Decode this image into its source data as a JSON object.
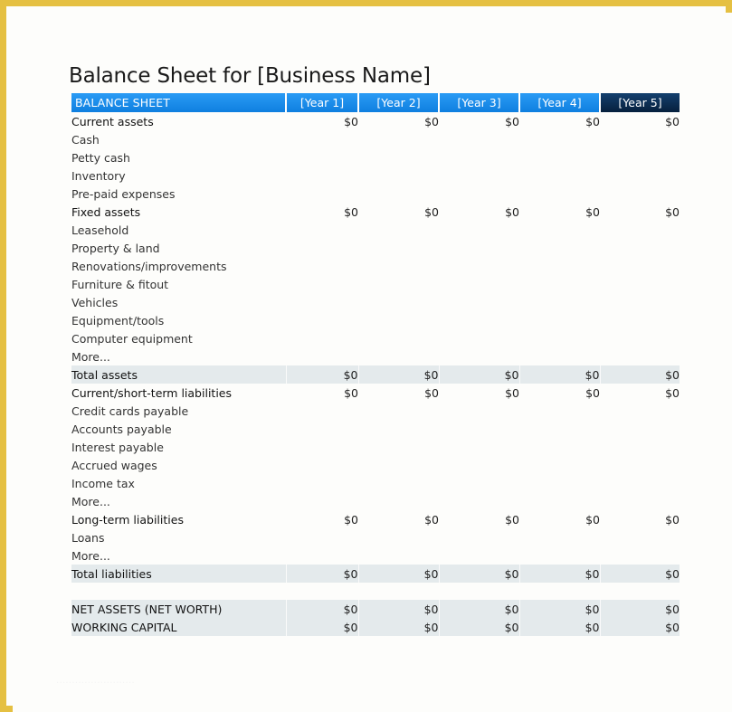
{
  "document": {
    "title": "Balance Sheet for [Business Name]",
    "frame_color": "#e5c042",
    "background_color": "#fdfdfb",
    "watermark": "........................."
  },
  "table": {
    "header": {
      "label": "BALANCE SHEET",
      "label_bg": "#1b8ef2",
      "year_bg": "#1b8ef2",
      "year_last_bg": "#0b2f55",
      "columns": [
        "[Year 1]",
        "[Year 2]",
        "[Year 3]",
        "[Year 4]",
        "[Year 5]"
      ]
    },
    "total_row_bg": "#e4eaec",
    "zero": "$0",
    "rows": [
      {
        "label": "Current assets",
        "kind": "section",
        "values": [
          "$0",
          "$0",
          "$0",
          "$0",
          "$0"
        ]
      },
      {
        "label": "Cash",
        "kind": "item",
        "values": [
          "",
          "",
          "",
          "",
          ""
        ]
      },
      {
        "label": "Petty cash",
        "kind": "item",
        "values": [
          "",
          "",
          "",
          "",
          ""
        ]
      },
      {
        "label": "Inventory",
        "kind": "item",
        "values": [
          "",
          "",
          "",
          "",
          ""
        ]
      },
      {
        "label": "Pre-paid expenses",
        "kind": "item",
        "values": [
          "",
          "",
          "",
          "",
          ""
        ]
      },
      {
        "label": "Fixed assets",
        "kind": "section",
        "values": [
          "$0",
          "$0",
          "$0",
          "$0",
          "$0"
        ]
      },
      {
        "label": "Leasehold",
        "kind": "item",
        "values": [
          "",
          "",
          "",
          "",
          ""
        ]
      },
      {
        "label": "Property & land",
        "kind": "item",
        "values": [
          "",
          "",
          "",
          "",
          ""
        ]
      },
      {
        "label": "Renovations/improvements",
        "kind": "item",
        "values": [
          "",
          "",
          "",
          "",
          ""
        ]
      },
      {
        "label": "Furniture & fitout",
        "kind": "item",
        "values": [
          "",
          "",
          "",
          "",
          ""
        ]
      },
      {
        "label": "Vehicles",
        "kind": "item",
        "values": [
          "",
          "",
          "",
          "",
          ""
        ]
      },
      {
        "label": "Equipment/tools",
        "kind": "item",
        "values": [
          "",
          "",
          "",
          "",
          ""
        ]
      },
      {
        "label": "Computer equipment",
        "kind": "item",
        "values": [
          "",
          "",
          "",
          "",
          ""
        ]
      },
      {
        "label": "More...",
        "kind": "item",
        "values": [
          "",
          "",
          "",
          "",
          ""
        ]
      },
      {
        "label": "Total assets",
        "kind": "total",
        "values": [
          "$0",
          "$0",
          "$0",
          "$0",
          "$0"
        ]
      },
      {
        "label": "Current/short-term liabilities",
        "kind": "section",
        "values": [
          "$0",
          "$0",
          "$0",
          "$0",
          "$0"
        ]
      },
      {
        "label": "Credit cards payable",
        "kind": "item",
        "values": [
          "",
          "",
          "",
          "",
          ""
        ]
      },
      {
        "label": "Accounts payable",
        "kind": "item",
        "values": [
          "",
          "",
          "",
          "",
          ""
        ]
      },
      {
        "label": "Interest payable",
        "kind": "item",
        "values": [
          "",
          "",
          "",
          "",
          ""
        ]
      },
      {
        "label": "Accrued wages",
        "kind": "item",
        "values": [
          "",
          "",
          "",
          "",
          ""
        ]
      },
      {
        "label": "Income tax",
        "kind": "item",
        "values": [
          "",
          "",
          "",
          "",
          ""
        ]
      },
      {
        "label": "More...",
        "kind": "item",
        "values": [
          "",
          "",
          "",
          "",
          ""
        ]
      },
      {
        "label": "Long-term liabilities",
        "kind": "section",
        "values": [
          "$0",
          "$0",
          "$0",
          "$0",
          "$0"
        ]
      },
      {
        "label": "Loans",
        "kind": "item",
        "values": [
          "",
          "",
          "",
          "",
          ""
        ]
      },
      {
        "label": "More...",
        "kind": "item",
        "values": [
          "",
          "",
          "",
          "",
          ""
        ]
      },
      {
        "label": "Total liabilities",
        "kind": "total",
        "values": [
          "$0",
          "$0",
          "$0",
          "$0",
          "$0"
        ]
      },
      {
        "label": "",
        "kind": "spacer",
        "values": [
          "",
          "",
          "",
          "",
          ""
        ]
      },
      {
        "label": "NET ASSETS (NET WORTH)",
        "kind": "total",
        "values": [
          "$0",
          "$0",
          "$0",
          "$0",
          "$0"
        ]
      },
      {
        "label": "WORKING CAPITAL",
        "kind": "total",
        "values": [
          "$0",
          "$0",
          "$0",
          "$0",
          "$0"
        ]
      }
    ]
  }
}
